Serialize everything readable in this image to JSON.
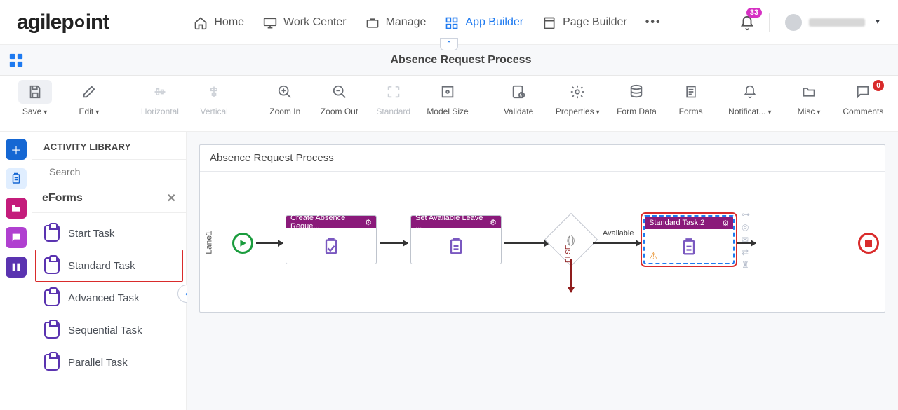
{
  "header": {
    "logo": "agilepoint",
    "nav": [
      {
        "label": "Home"
      },
      {
        "label": "Work Center"
      },
      {
        "label": "Manage"
      },
      {
        "label": "App Builder"
      },
      {
        "label": "Page Builder"
      }
    ],
    "notif_count": "33"
  },
  "pagebar": {
    "title": "Absence Request Process"
  },
  "toolbar": [
    {
      "label": "Save",
      "dis": false,
      "caret": true
    },
    {
      "label": "Edit",
      "dis": false,
      "caret": true
    },
    {
      "label": "Horizontal",
      "dis": true
    },
    {
      "label": "Vertical",
      "dis": true
    },
    {
      "label": "Zoom In",
      "dis": false
    },
    {
      "label": "Zoom Out",
      "dis": false
    },
    {
      "label": "Standard",
      "dis": true
    },
    {
      "label": "Model Size",
      "dis": false
    },
    {
      "label": "Validate",
      "dis": false
    },
    {
      "label": "Properties",
      "dis": false,
      "caret": true
    },
    {
      "label": "Form Data",
      "dis": false
    },
    {
      "label": "Forms",
      "dis": false
    },
    {
      "label": "Notificat...",
      "dis": false,
      "caret": true
    },
    {
      "label": "Misc",
      "dis": false,
      "caret": true
    }
  ],
  "comments": {
    "label": "Comments",
    "count": "0"
  },
  "library": {
    "title": "ACTIVITY LIBRARY",
    "search_placeholder": "Search",
    "section": "eForms",
    "items": [
      {
        "label": "Start Task"
      },
      {
        "label": "Standard Task",
        "selected": true
      },
      {
        "label": "Advanced Task"
      },
      {
        "label": "Sequential Task"
      },
      {
        "label": "Parallel Task"
      }
    ]
  },
  "canvas": {
    "title": "Absence Request Process",
    "lane": "Lane1",
    "nodes": {
      "n1": "Create Absence Reque...",
      "n2": "Set Available Leave ...",
      "n3": "Standard Task.2"
    },
    "edges": {
      "available": "Available",
      "else": "ELSE"
    }
  }
}
